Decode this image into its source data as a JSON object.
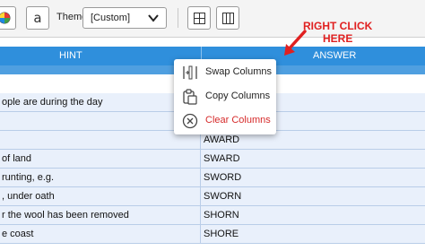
{
  "toolbar": {
    "font_button_glyph": "a",
    "theme_label": "Theme",
    "theme_value": "[Custom]"
  },
  "grid": {
    "headers": [
      "HINT",
      "ANSWER"
    ],
    "rows": [
      {
        "hint": "ople are during the day",
        "answer": ""
      },
      {
        "hint": "",
        "answer": ""
      },
      {
        "hint": "",
        "answer": "AWARD"
      },
      {
        "hint": "of land",
        "answer": "SWARD"
      },
      {
        "hint": "runting, e.g.",
        "answer": "SWORD"
      },
      {
        "hint": ", under oath",
        "answer": "SWORN"
      },
      {
        "hint": "r the wool has been removed",
        "answer": "SHORN"
      },
      {
        "hint": "e coast",
        "answer": "SHORE"
      }
    ]
  },
  "context_menu": {
    "items": [
      {
        "label": "Swap Columns",
        "icon": "swap-columns-icon"
      },
      {
        "label": "Copy Columns",
        "icon": "copy-columns-icon"
      },
      {
        "label": "Clear Columns",
        "icon": "clear-columns-icon"
      }
    ]
  },
  "annotation": {
    "line1": "RIGHT CLICK",
    "line2": "HERE",
    "color": "#e02020"
  },
  "colors": {
    "header_blue": "#2f8fdc",
    "row_bg": "#e9f0fb",
    "clear_red": "#d62b2b"
  }
}
